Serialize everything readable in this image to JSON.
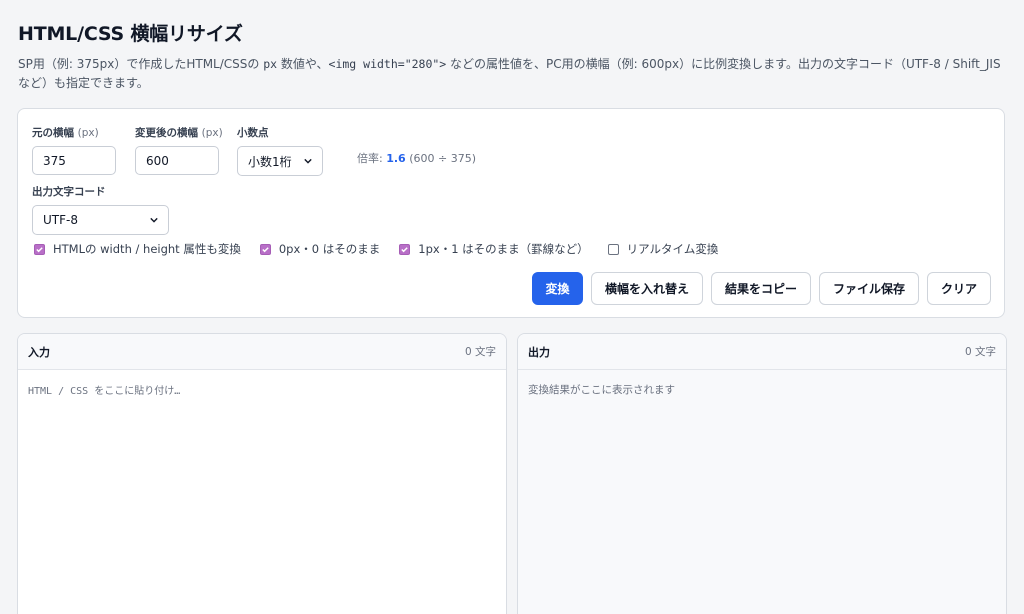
{
  "header": {
    "title": "HTML/CSS 横幅リサイズ",
    "desc_1": "SP用（例: 375px）で作成したHTML/CSSの ",
    "desc_code_1": "px",
    "desc_2": " 数値や、",
    "desc_code_2": "<img width=\"280\">",
    "desc_3": " などの属性値を、PC用の横幅（例: 600px）に比例変換します。出力の文字コード（UTF-8 / Shift_JIS など）も指定できます。"
  },
  "controls": {
    "source_width": {
      "label": "元の横幅",
      "unit": "(px)",
      "value": "375"
    },
    "target_width": {
      "label": "変更後の横幅",
      "unit": "(px)",
      "value": "600"
    },
    "decimals": {
      "label": "小数点",
      "selected": "小数1桁"
    },
    "ratio": {
      "prefix": "倍率:",
      "value": "1.6",
      "detail": "(600 ÷ 375)"
    },
    "encoding": {
      "label": "出力文字コード",
      "selected": "UTF-8"
    }
  },
  "options": [
    {
      "label": "HTMLの width / height 属性も変換",
      "checked": true
    },
    {
      "label": "0px・0 はそのまま",
      "checked": true
    },
    {
      "label": "1px・1 はそのまま（罫線など）",
      "checked": true
    },
    {
      "label": "リアルタイム変換",
      "checked": false
    }
  ],
  "buttons": {
    "convert": "変換",
    "swap": "横幅を入れ替え",
    "copy": "結果をコピー",
    "save": "ファイル保存",
    "clear": "クリア"
  },
  "input_pane": {
    "title": "入力",
    "count": "0 文字",
    "placeholder": "HTML / CSS をここに貼り付け…"
  },
  "output_pane": {
    "title": "出力",
    "count": "0 文字",
    "placeholder": "変換結果がここに表示されます"
  },
  "colors": {
    "accent": "#2563eb",
    "checkbox": "#b86fc7"
  },
  "icons": {
    "select_arrow": "chevron-down-icon",
    "check": "check-icon"
  }
}
